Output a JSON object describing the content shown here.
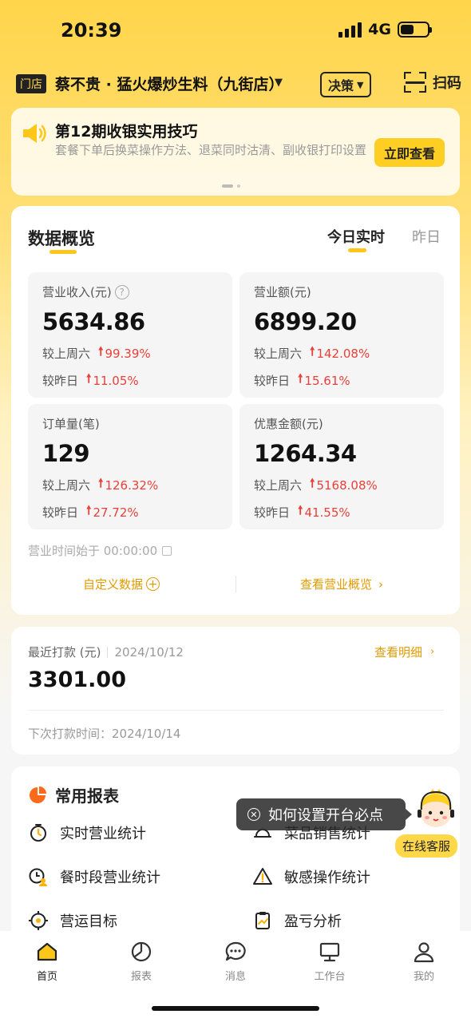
{
  "status_bar": {
    "time": "20:39",
    "network": "4G"
  },
  "header": {
    "store_tag": "门店",
    "store_name": "蔡不贵 · 猛火爆炒生料（九街店）",
    "decision_label": "决策",
    "scan_label": "扫码"
  },
  "banner": {
    "title": "第12期收银实用技巧",
    "description": "套餐下单后换菜操作方法、退菜同时沽清、副收银打印设置",
    "button": "立即查看"
  },
  "overview": {
    "title": "数据概览",
    "tab_today": "今日实时",
    "tab_yesterday": "昨日",
    "metrics": [
      {
        "label": "营业收入(元)",
        "value": "5634.86",
        "week_label": "较上周六",
        "week_change": "99.39%",
        "day_label": "较昨日",
        "day_change": "11.05%"
      },
      {
        "label": "营业额(元)",
        "value": "6899.20",
        "week_label": "较上周六",
        "week_change": "142.08%",
        "day_label": "较昨日",
        "day_change": "15.61%"
      },
      {
        "label": "订单量(笔)",
        "value": "129",
        "week_label": "较上周六",
        "week_change": "126.32%",
        "day_label": "较昨日",
        "day_change": "27.72%"
      },
      {
        "label": "优惠金额(元)",
        "value": "1264.34",
        "week_label": "较上周六",
        "week_change": "5168.08%",
        "day_label": "较昨日",
        "day_change": "41.55%"
      }
    ],
    "business_time": "营业时间始于 00:00:00",
    "custom_data": "自定义数据",
    "view_overview": "查看营业概览"
  },
  "payment": {
    "label": "最近打款 (元)",
    "date": "2024/10/12",
    "detail_link": "查看明细",
    "amount": "3301.00",
    "next_time": "下次打款时间：2024/10/14"
  },
  "reports": {
    "title": "常用报表",
    "items": [
      {
        "label": "实时营业统计",
        "icon": "timer-icon"
      },
      {
        "label": "菜品销售统计",
        "icon": "dish-icon"
      },
      {
        "label": "餐时段营业统计",
        "icon": "clock-user-icon"
      },
      {
        "label": "敏感操作统计",
        "icon": "warning-icon"
      },
      {
        "label": "营运目标",
        "icon": "target-icon"
      },
      {
        "label": "盈亏分析",
        "icon": "clipboard-chart-icon"
      }
    ]
  },
  "tooltip": {
    "text": "如何设置开台必点"
  },
  "service": {
    "label": "在线客服"
  },
  "tabbar": {
    "items": [
      {
        "label": "首页",
        "icon": "home-icon",
        "active": true
      },
      {
        "label": "报表",
        "icon": "report-icon",
        "active": false
      },
      {
        "label": "消息",
        "icon": "message-icon",
        "active": false
      },
      {
        "label": "工作台",
        "icon": "monitor-icon",
        "active": false
      },
      {
        "label": "我的",
        "icon": "user-icon",
        "active": false
      }
    ]
  },
  "colors": {
    "accent": "#ffc61a",
    "link": "#e39a00",
    "up": "#e8403a"
  }
}
